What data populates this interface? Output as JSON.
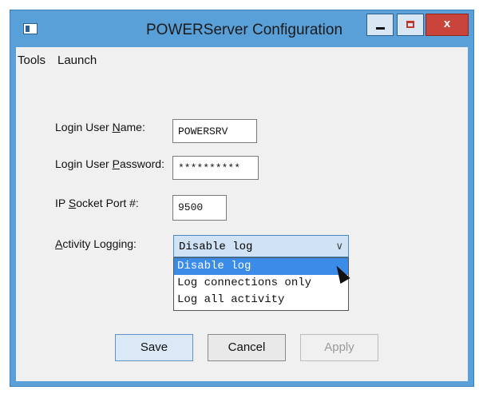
{
  "window": {
    "title": "POWERServer Configuration",
    "close_label": "x"
  },
  "menu": {
    "items": [
      "Tools",
      "Launch"
    ]
  },
  "form": {
    "user_name": {
      "label_pre": "Login User ",
      "label_u": "N",
      "label_post": "ame:",
      "value": "POWERSRV"
    },
    "password": {
      "label_pre": "Login User ",
      "label_u": "P",
      "label_post": "assword:",
      "value": "**********"
    },
    "port": {
      "label_pre": "IP ",
      "label_u": "S",
      "label_post": "ocket Port #:",
      "value": "9500"
    },
    "logging": {
      "label_pre": "",
      "label_u": "A",
      "label_post": "ctivity Logging:",
      "value": "Disable log",
      "options": [
        "Disable log",
        "Log connections only",
        "Log all activity"
      ]
    }
  },
  "buttons": {
    "save": "Save",
    "cancel": "Cancel",
    "apply": "Apply"
  }
}
